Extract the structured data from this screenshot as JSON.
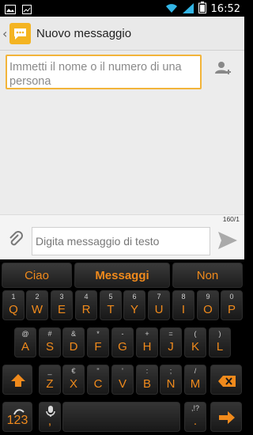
{
  "status_bar": {
    "time": "16:52"
  },
  "action_bar": {
    "title": "Nuovo messaggio"
  },
  "recipients": {
    "placeholder": "Immetti il nome o il numero di una persona"
  },
  "composer": {
    "counter": "160/1",
    "placeholder": "Digita messaggio di testo"
  },
  "keyboard": {
    "suggestions": [
      "Ciao",
      "Messaggi",
      "Non"
    ],
    "row1": [
      {
        "key": "Q",
        "alt": "1"
      },
      {
        "key": "W",
        "alt": "2"
      },
      {
        "key": "E",
        "alt": "3"
      },
      {
        "key": "R",
        "alt": "4"
      },
      {
        "key": "T",
        "alt": "5"
      },
      {
        "key": "Y",
        "alt": "6"
      },
      {
        "key": "U",
        "alt": "7"
      },
      {
        "key": "I",
        "alt": "8"
      },
      {
        "key": "O",
        "alt": "9"
      },
      {
        "key": "P",
        "alt": "0"
      }
    ],
    "row2": [
      {
        "key": "A",
        "alt": "@"
      },
      {
        "key": "S",
        "alt": "#"
      },
      {
        "key": "D",
        "alt": "&"
      },
      {
        "key": "F",
        "alt": "*"
      },
      {
        "key": "G",
        "alt": "-"
      },
      {
        "key": "H",
        "alt": "+"
      },
      {
        "key": "J",
        "alt": "="
      },
      {
        "key": "K",
        "alt": "("
      },
      {
        "key": "L",
        "alt": ")"
      }
    ],
    "row3": [
      {
        "key": "Z",
        "alt": "_"
      },
      {
        "key": "X",
        "alt": "€"
      },
      {
        "key": "C",
        "alt": "\""
      },
      {
        "key": "V",
        "alt": "'"
      },
      {
        "key": "B",
        "alt": ":"
      },
      {
        "key": "N",
        "alt": ";"
      },
      {
        "key": "M",
        "alt": "/"
      }
    ],
    "row4": {
      "numbers_label": "123",
      "mic_alt": ",",
      "comma": ",",
      "period_alt": ",!?",
      "period": "."
    }
  },
  "colors": {
    "accent": "#f08a1c",
    "recipient_border": "#f2b43a",
    "app_icon": "#f4b422"
  }
}
